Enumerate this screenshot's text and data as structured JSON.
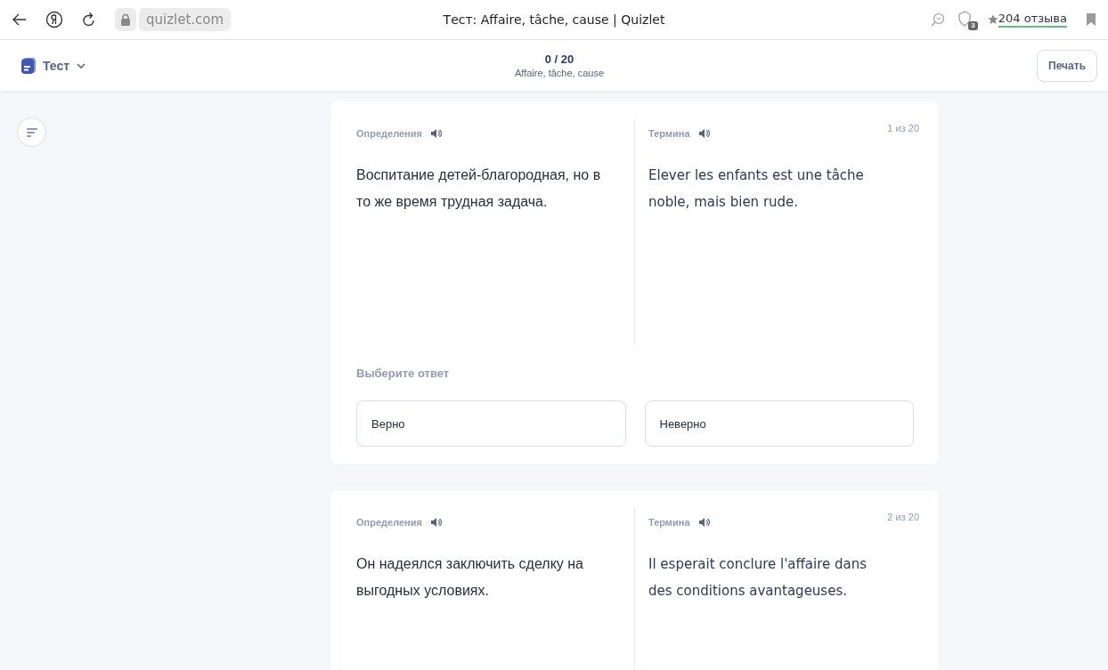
{
  "browser": {
    "url": "quizlet.com",
    "title": "Тест: Affaire, tâche, cause | Quizlet",
    "badge_count": "3",
    "reviews": "204 отзыва"
  },
  "header": {
    "mode": "Тест",
    "progress": "0 / 20",
    "set_title": "Affaire, tâche, cause",
    "print": "Печать"
  },
  "questions": [
    {
      "definition_label": "Определения",
      "term_label": "Термина",
      "counter": "1 из 20",
      "definition": "Воспитание детей-благородная, но в то же время трудная задача.",
      "term": "Elever les enfants est une tâche noble, mais bien rude.",
      "prompt": "Выберите ответ",
      "options": [
        {
          "label": "Верно"
        },
        {
          "label": "Неверно"
        }
      ]
    },
    {
      "definition_label": "Определения",
      "term_label": "Термина",
      "counter": "2 из 20",
      "definition": "Он надеялся заключить сделку на выгодных условиях.",
      "term": "Il esperait conclure l'affaire dans des conditions avantageuses."
    }
  ]
}
